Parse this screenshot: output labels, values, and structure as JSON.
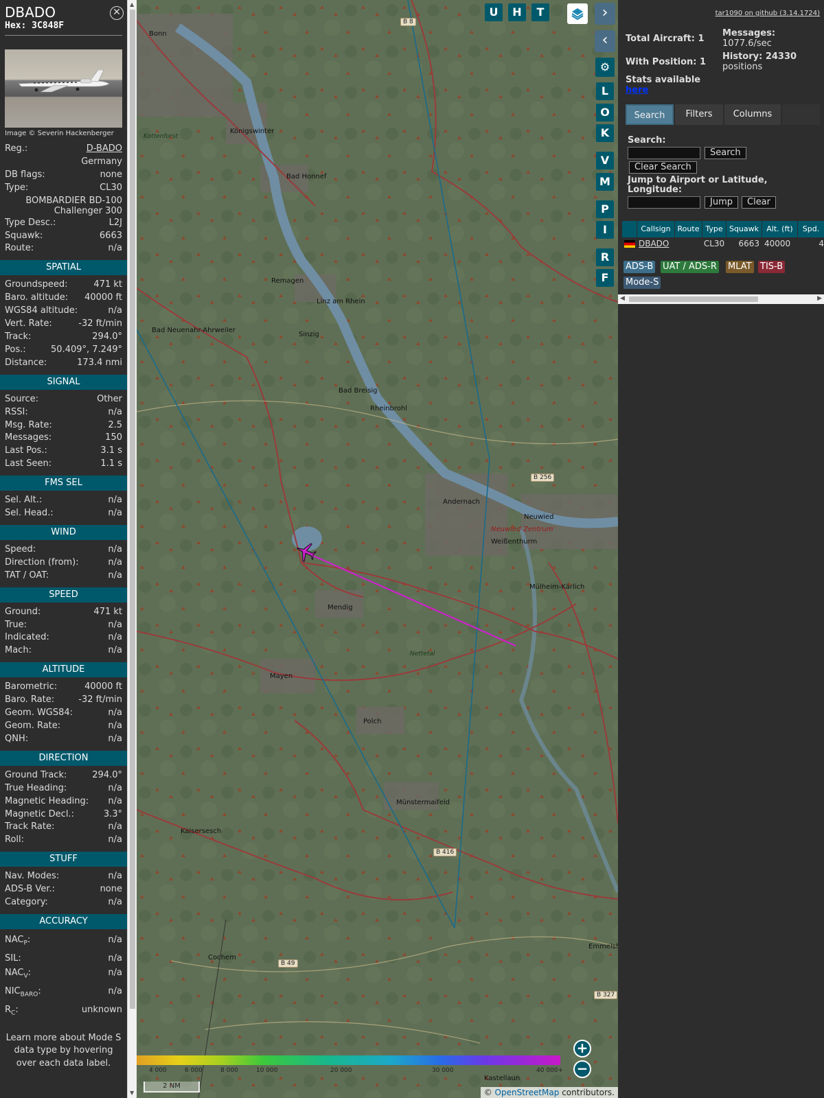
{
  "aircraft": {
    "callsign": "DBADO",
    "hex_label": "Hex: 3C848F",
    "photo_credit": "Image © Severin Hackenberger",
    "close_icon": "close-icon"
  },
  "details": [
    {
      "label": "Reg.:",
      "value": "D-BADO"
    },
    {
      "label": "",
      "value": "Germany"
    },
    {
      "label": "DB flags:",
      "value": "none"
    },
    {
      "label": "Type:",
      "value": "CL30"
    },
    {
      "label": "",
      "value": "BOMBARDIER BD-100 Challenger 300"
    },
    {
      "label": "Type Desc.:",
      "value": "L2J"
    },
    {
      "label": "Squawk:",
      "value": "6663"
    },
    {
      "label": "Route:",
      "value": "n/a"
    }
  ],
  "sections": [
    {
      "title": "SPATIAL",
      "rows": [
        {
          "label": "Groundspeed:",
          "value": "471 kt"
        },
        {
          "label": "Baro. altitude:",
          "value": "40000 ft"
        },
        {
          "label": "WGS84 altitude:",
          "value": "n/a"
        },
        {
          "label": "Vert. Rate:",
          "value": "-32 ft/min"
        },
        {
          "label": "Track:",
          "value": "294.0°"
        },
        {
          "label": "Pos.:",
          "value": "50.409°, 7.249°"
        },
        {
          "label": "Distance:",
          "value": "173.4 nmi"
        }
      ]
    },
    {
      "title": "SIGNAL",
      "rows": [
        {
          "label": "Source:",
          "value": "Other"
        },
        {
          "label": "RSSI:",
          "value": "n/a"
        },
        {
          "label": "Msg. Rate:",
          "value": "2.5"
        },
        {
          "label": "Messages:",
          "value": "150"
        },
        {
          "label": "",
          "value": ""
        },
        {
          "label": "Last Pos.:",
          "value": "3.1 s"
        },
        {
          "label": "Last Seen:",
          "value": "1.1 s"
        }
      ]
    },
    {
      "title": "FMS SEL",
      "rows": [
        {
          "label": "Sel. Alt.:",
          "value": "n/a"
        },
        {
          "label": "Sel. Head.:",
          "value": "n/a"
        }
      ]
    },
    {
      "title": "WIND",
      "rows": [
        {
          "label": "Speed:",
          "value": "n/a"
        },
        {
          "label": "Direction (from):",
          "value": "n/a"
        },
        {
          "label": "TAT / OAT:",
          "value": "n/a"
        }
      ]
    },
    {
      "title": "SPEED",
      "rows": [
        {
          "label": "Ground:",
          "value": "471 kt"
        },
        {
          "label": "True:",
          "value": "n/a"
        },
        {
          "label": "Indicated:",
          "value": "n/a"
        },
        {
          "label": "Mach:",
          "value": "n/a"
        }
      ]
    },
    {
      "title": "ALTITUDE",
      "rows": [
        {
          "label": "Barometric:",
          "value": "40000 ft"
        },
        {
          "label": "Baro. Rate:",
          "value": "-32 ft/min"
        },
        {
          "label": "Geom. WGS84:",
          "value": "n/a"
        },
        {
          "label": "Geom. Rate:",
          "value": "n/a"
        },
        {
          "label": "QNH:",
          "value": "n/a"
        }
      ]
    },
    {
      "title": "DIRECTION",
      "rows": [
        {
          "label": "Ground Track:",
          "value": "294.0°"
        },
        {
          "label": "True Heading:",
          "value": "n/a"
        },
        {
          "label": "Magnetic Heading:",
          "value": "n/a"
        },
        {
          "label": "Magnetic Decl.:",
          "value": "3.3°"
        },
        {
          "label": "Track Rate:",
          "value": "n/a"
        },
        {
          "label": "Roll:",
          "value": "n/a"
        }
      ]
    },
    {
      "title": "STUFF",
      "rows": [
        {
          "label": "Nav. Modes:",
          "value": "n/a"
        },
        {
          "label": "ADS-B Ver.:",
          "value": "none"
        },
        {
          "label": "Category:",
          "value": "n/a"
        },
        {
          "label": "",
          "value": ""
        }
      ]
    },
    {
      "title": "ACCURACY",
      "rows": [
        {
          "label": "NACP:",
          "value": "n/a"
        },
        {
          "label": "SIL:",
          "value": "n/a"
        },
        {
          "label": "NACV:",
          "value": "n/a"
        },
        {
          "label": "NICBARO:",
          "value": "n/a"
        },
        {
          "label": "RC:",
          "value": "unknown"
        }
      ]
    }
  ],
  "learn_more": "Learn more about Mode S data type by hovering over each data label.",
  "map": {
    "places": [
      {
        "name": "Bonn"
      },
      {
        "name": "Königswinter"
      },
      {
        "name": "Bad Honnef"
      },
      {
        "name": "Kottenforst"
      },
      {
        "name": "Remagen"
      },
      {
        "name": "Linz am Rhein"
      },
      {
        "name": "Bad Neuenahr-Ahrweiler"
      },
      {
        "name": "Sinzig"
      },
      {
        "name": "Bad Breisig"
      },
      {
        "name": "Rheinbrohl"
      },
      {
        "name": "Andernach"
      },
      {
        "name": "Neuwied"
      },
      {
        "name": "Neuwied-Zentrum"
      },
      {
        "name": "Weißenthurm"
      },
      {
        "name": "Mülheim-Kärlich"
      },
      {
        "name": "Mendig"
      },
      {
        "name": "Nettetal"
      },
      {
        "name": "Mayen"
      },
      {
        "name": "Polch"
      },
      {
        "name": "Münstermaifeld"
      },
      {
        "name": "Kaisersesch"
      },
      {
        "name": "Cochem"
      },
      {
        "name": "Emmelsh"
      },
      {
        "name": "Kastellaun"
      }
    ],
    "roads": [
      "B 8",
      "B 256",
      "B 416",
      "B 49",
      "B 327"
    ],
    "buttons": [
      "U",
      "H",
      "T"
    ],
    "side_buttons": [
      "L",
      "O",
      "K",
      "V",
      "M",
      "P",
      "I",
      "R",
      "F"
    ],
    "altitude_labels": [
      "4 000",
      "6 000",
      "8 000",
      "10 000",
      "20 000",
      "30 000",
      "40 000+"
    ],
    "scale_label": "2 NM",
    "attribution_prefix": "© ",
    "attribution_link": "OpenStreetMap",
    "attribution_suffix": " contributors."
  },
  "sidebar": {
    "github": "tar1090 on github (3.14.1724)",
    "total_aircraft": "Total Aircraft: 1",
    "with_position": "With Position: 1",
    "stats_available": "Stats available",
    "here": "here",
    "messages_label": "Messages:",
    "messages_value": "1077.6/sec",
    "history_label": "History: 24330",
    "history_value": "positions",
    "tabs": [
      "Search",
      "Filters",
      "Columns"
    ],
    "search_label": "Search:",
    "search_button": "Search",
    "clear_search": "Clear Search",
    "jump_label": "Jump to Airport or Latitude, Longitude:",
    "jump_button": "Jump",
    "clear_button": "Clear",
    "table_headers": [
      "",
      "Callsign",
      "Route",
      "Type",
      "Squawk",
      "Alt. (ft)",
      "Spd."
    ],
    "table_row": {
      "callsign": "DBADO",
      "route": "",
      "type": "CL30",
      "squawk": "6663",
      "alt": "40000",
      "spd": "4"
    },
    "sources": [
      "ADS-B",
      "UAT / ADS-R",
      "MLAT",
      "TIS-B",
      "Mode-S"
    ]
  },
  "colors": {
    "accent": "#00596b",
    "track_magenta": "#cc22cc",
    "range_line": "#1a6a8a",
    "adsb": "#3d6f8c",
    "uat": "#2e7a3c",
    "mlat": "#7a5a2a",
    "tisb": "#8a2a36"
  }
}
